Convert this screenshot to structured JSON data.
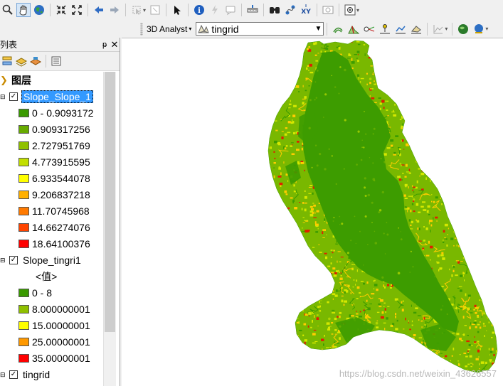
{
  "toolbar1": {
    "buttons": [
      "zoom-in-icon",
      "pan-icon",
      "globe-icon",
      "fixed-zoom-in-icon",
      "fixed-zoom-out-icon",
      "back-icon",
      "forward-icon",
      "select-features-icon",
      "clear-selection-icon",
      "select-elements-icon",
      "identify-icon",
      "hyperlink-icon",
      "html-popup-icon",
      "measure-icon",
      "find-icon",
      "find-route-icon",
      "go-to-xy-icon",
      "time-slider-icon",
      "create-viewer-icon"
    ]
  },
  "toolbar2": {
    "analyst_label": "3D Analyst",
    "layer_value": "tingrid"
  },
  "toc": {
    "title": "列表",
    "pin": "ᵽ",
    "close": "✕",
    "group": "图层",
    "layers": [
      {
        "name": "Slope_Slope_1",
        "selected": true,
        "classes": [
          {
            "label": "0 - 0.9093172",
            "color": "#3a9a00"
          },
          {
            "label": "0.909317256",
            "color": "#67ab00"
          },
          {
            "label": "2.727951769",
            "color": "#8fc000"
          },
          {
            "label": "4.773915595",
            "color": "#c2df00"
          },
          {
            "label": "6.933544078",
            "color": "#ffff00"
          },
          {
            "label": "9.206837218",
            "color": "#ffb000"
          },
          {
            "label": "11.70745968",
            "color": "#ff7a00"
          },
          {
            "label": "14.66274076",
            "color": "#ff4400"
          },
          {
            "label": "18.64100376",
            "color": "#ff0000"
          }
        ]
      },
      {
        "name": "Slope_tingri1",
        "selected": false,
        "value_label": "<值>",
        "classes": [
          {
            "label": "0 - 8",
            "color": "#3a9a00"
          },
          {
            "label": "8.000000001",
            "color": "#8fc000"
          },
          {
            "label": "15.00000001",
            "color": "#ffff00"
          },
          {
            "label": "25.00000001",
            "color": "#ff9900"
          },
          {
            "label": "35.00000001",
            "color": "#ff0000"
          }
        ]
      },
      {
        "name": "tingrid",
        "selected": false
      }
    ]
  },
  "map": {
    "watermark": "https://blog.csdn.net/weixin_43626557",
    "colors": {
      "flat": "#3d9c00",
      "low": "#79b800",
      "mid": "#d4e800",
      "high": "#ffcc00",
      "steep": "#e02000"
    }
  }
}
